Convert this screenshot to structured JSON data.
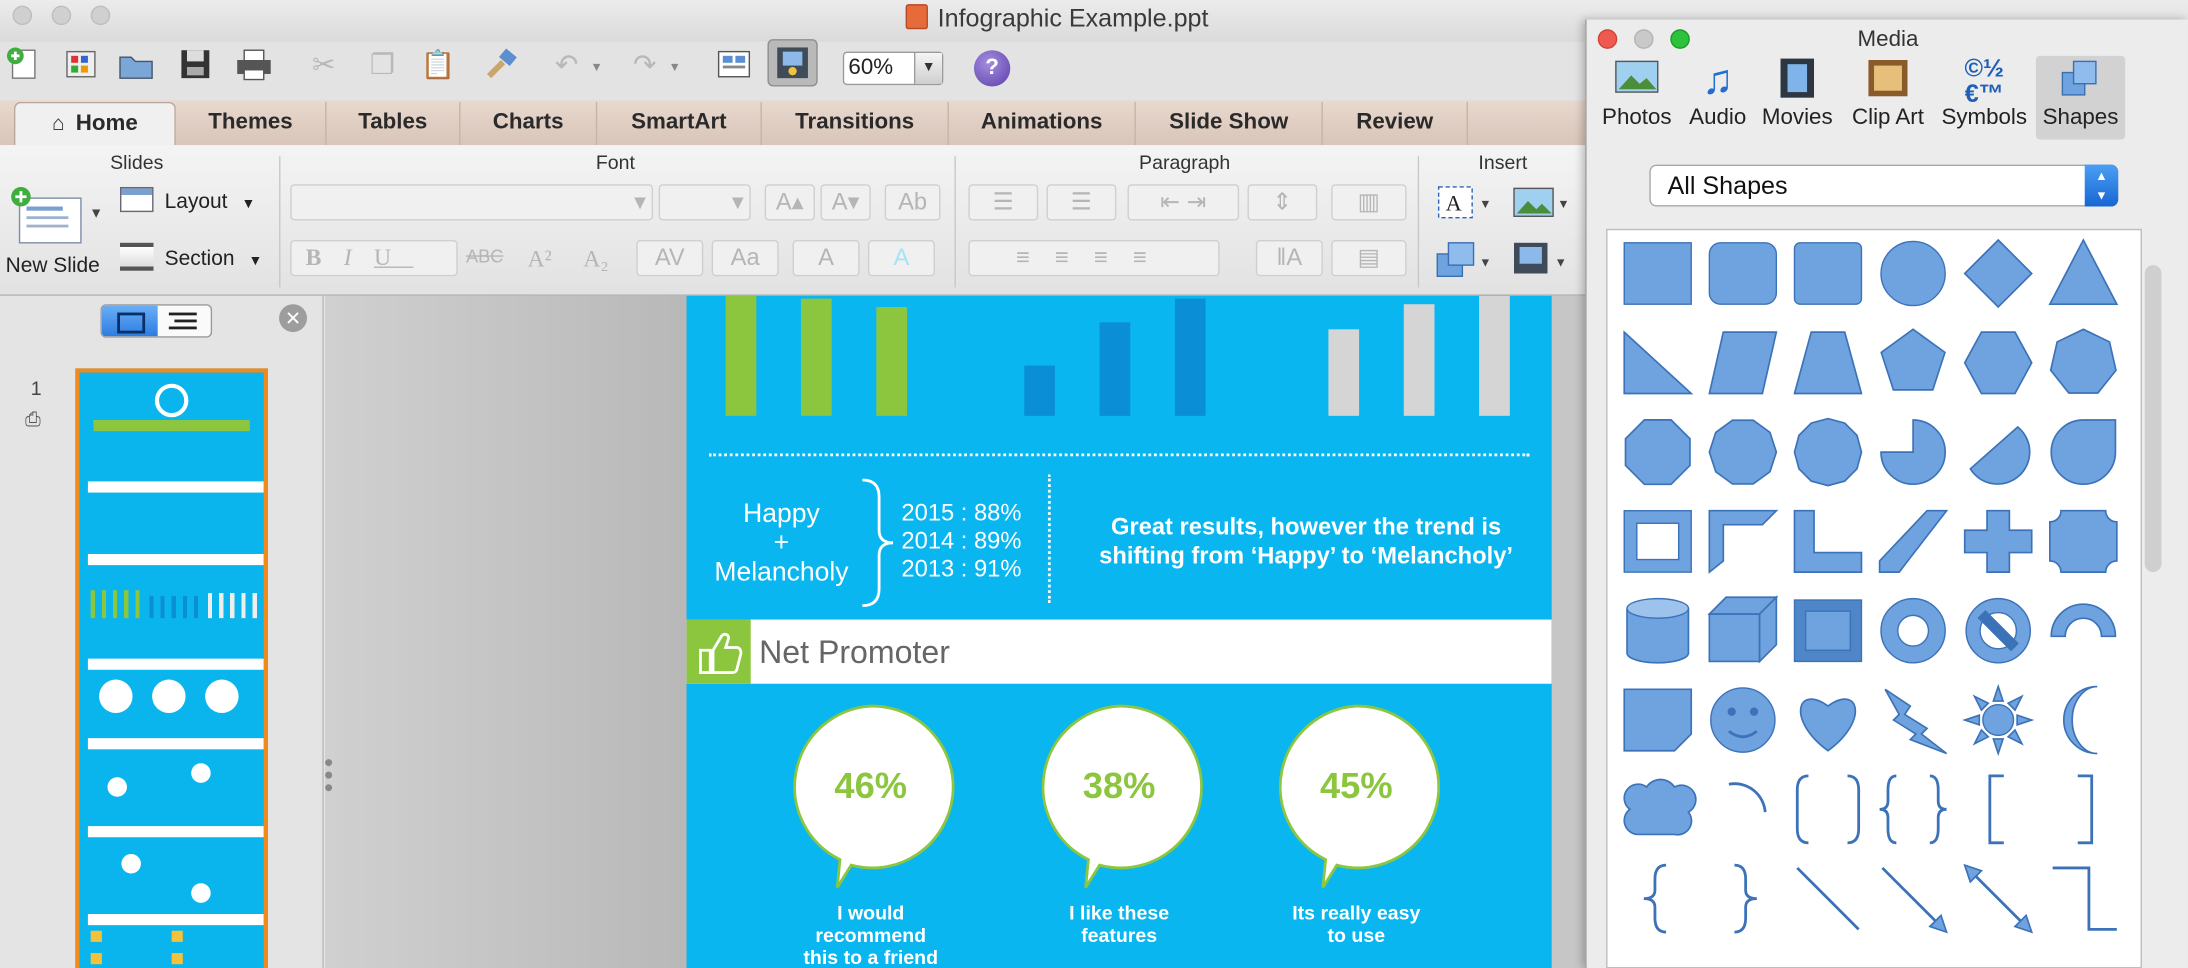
{
  "window": {
    "title": "Infographic Example.ppt"
  },
  "toolbar": {
    "zoom": "60%",
    "icons": [
      "new-file-icon",
      "gallery-icon",
      "open-folder-icon",
      "save-icon",
      "print-icon",
      "cut-icon",
      "copy-icon",
      "paste-icon",
      "format-painter-icon",
      "undo-icon",
      "redo-icon",
      "slide-sorter-icon",
      "media-browser-icon",
      "help-icon"
    ]
  },
  "tabs": [
    "Home",
    "Themes",
    "Tables",
    "Charts",
    "SmartArt",
    "Transitions",
    "Animations",
    "Slide Show",
    "Review"
  ],
  "ribbon": {
    "groups": {
      "slides": "Slides",
      "font": "Font",
      "paragraph": "Paragraph",
      "insert": "Insert"
    },
    "new_slide": "New Slide",
    "layout": "Layout",
    "section": "Section"
  },
  "slides_panel": {
    "slide_number": "1"
  },
  "slide": {
    "happy_label": "Happy",
    "plus": "+",
    "melancholy_label": "Melancholy",
    "stats": [
      "2015 : 88%",
      "2014 : 89%",
      "2013 : 91%"
    ],
    "result_line1": "Great results, however the trend is",
    "result_line2": "shifting from ‘Happy’ to ‘Melancholy’",
    "section_title": "Net Promoter",
    "bubbles": [
      {
        "pct": "46%",
        "line1": "I would",
        "line2": "recommend",
        "line3": "this to a friend"
      },
      {
        "pct": "38%",
        "line1": "I like these",
        "line2": "features",
        "line3": ""
      },
      {
        "pct": "45%",
        "line1": "Its really easy",
        "line2": "to use",
        "line3": ""
      }
    ],
    "bar_groups": [
      {
        "color": "#8cc63f",
        "values": [
          95,
          88,
          82
        ]
      },
      {
        "color": "#0a8fd6",
        "values": [
          38,
          70,
          88
        ]
      },
      {
        "color": "#d5d5d5",
        "values": [
          65,
          84,
          90
        ]
      }
    ]
  },
  "media": {
    "title": "Media",
    "tabs": [
      "Photos",
      "Audio",
      "Movies",
      "Clip Art",
      "Symbols",
      "Shapes"
    ],
    "selected_tab": "Shapes",
    "filter": "All Shapes"
  },
  "colors": {
    "accent_blue": "#0ab6ef",
    "accent_green": "#8cc63f",
    "thumb_border": "#f08a1c",
    "shape_fill": "#6fa3df"
  }
}
